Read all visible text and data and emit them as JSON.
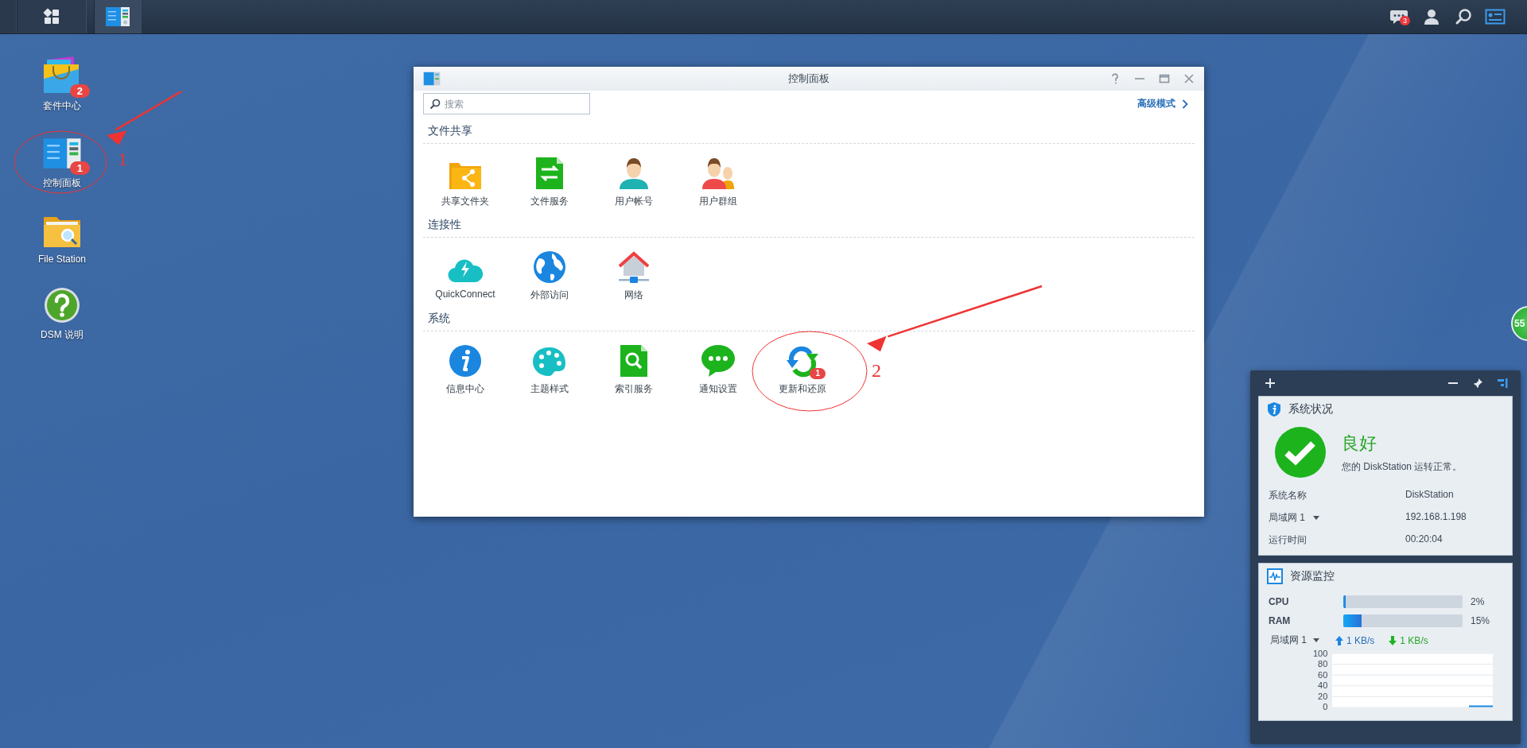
{
  "taskbar": {
    "apps": [
      {
        "kind": "control-panel",
        "selected": true
      }
    ],
    "notifications": {
      "badge": "3"
    }
  },
  "desktop_icons": [
    {
      "label": "套件中心",
      "kind": "package",
      "badge": "2"
    },
    {
      "label": "控制面板",
      "kind": "control-panel",
      "badge": "1"
    },
    {
      "label": "File Station",
      "kind": "file-station"
    },
    {
      "label": "DSM 说明",
      "kind": "help"
    }
  ],
  "window": {
    "title": "控制面板",
    "search": {
      "placeholder": "搜索"
    },
    "advanced_link": "高级模式",
    "sections": [
      {
        "title": "文件共享",
        "items": [
          {
            "label": "共享文件夹",
            "kind": "shared-folder"
          },
          {
            "label": "文件服务",
            "kind": "file-services"
          },
          {
            "label": "用户帐号",
            "kind": "user"
          },
          {
            "label": "用户群组",
            "kind": "group"
          }
        ]
      },
      {
        "title": "连接性",
        "items": [
          {
            "label": "QuickConnect",
            "kind": "quickconnect"
          },
          {
            "label": "外部访问",
            "kind": "external-access"
          },
          {
            "label": "网络",
            "kind": "network"
          }
        ]
      },
      {
        "title": "系统",
        "items": [
          {
            "label": "信息中心",
            "kind": "info"
          },
          {
            "label": "主题样式",
            "kind": "theme"
          },
          {
            "label": "索引服务",
            "kind": "indexing"
          },
          {
            "label": "通知设置",
            "kind": "notification"
          },
          {
            "label": "更新和还原",
            "kind": "update",
            "badge": "1"
          }
        ]
      }
    ]
  },
  "annotations": [
    {
      "label": "1"
    },
    {
      "label": "2"
    }
  ],
  "widgets": {
    "system_status": {
      "title": "系统状况",
      "status": "良好",
      "message": "您的 DiskStation 运转正常。",
      "rows": [
        {
          "label": "系统名称",
          "value": "DiskStation",
          "dropdown": false
        },
        {
          "label": "局域网 1",
          "value": "192.168.1.198",
          "dropdown": true
        },
        {
          "label": "运行时间",
          "value": "00:20:04",
          "dropdown": false
        }
      ]
    },
    "resource_monitor": {
      "title": "资源监控",
      "meters": [
        {
          "label": "CPU",
          "level": 0.02,
          "reading": "2%"
        },
        {
          "label": "RAM",
          "level": 0.15,
          "reading": "15%"
        }
      ],
      "network": {
        "label": "局域网 1",
        "upload": "1 KB/s",
        "download": "1 KB/s"
      },
      "chart": {
        "tick_labels": [
          "100",
          "80",
          "60",
          "40",
          "20",
          "0"
        ]
      }
    }
  },
  "side_badge": {
    "text": "55"
  }
}
